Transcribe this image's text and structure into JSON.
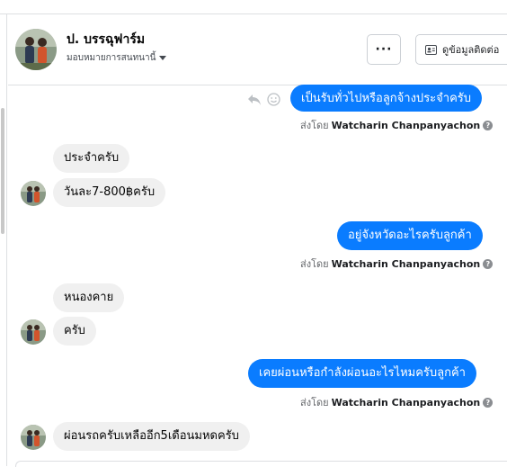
{
  "header": {
    "name": "ป. บรรฉุฟาร์ม",
    "assign_label": "มอบหมายการสนทนานี้",
    "more_label": "···",
    "view_label": "ดูข้อมูลติดต่อ"
  },
  "messages": [
    {
      "type": "out",
      "text": "เป็นรับทั่วไปหรือลูกจ้างประจำครับ",
      "sent_prefix": "ส่งโดย",
      "sent_by": "Watcharin Chanpanyachon"
    },
    {
      "type": "in",
      "text": "ประจำครับ"
    },
    {
      "type": "in",
      "text": "วันละ7-800฿ครับ"
    },
    {
      "type": "out",
      "text": "อยู่จังหวัดอะไรครับลูกค้า",
      "sent_prefix": "ส่งโดย",
      "sent_by": "Watcharin Chanpanyachon"
    },
    {
      "type": "in",
      "text": "หนองคาย"
    },
    {
      "type": "in",
      "text": "ครับ"
    },
    {
      "type": "out",
      "text": "เคยผ่อนหรือกำลังผ่อนอะไรไหมครับลูกค้า",
      "sent_prefix": "ส่งโดย",
      "sent_by": "Watcharin Chanpanyachon"
    },
    {
      "type": "in",
      "text": "ผ่อนรถครับเหลืออีก5เดือนมหดครับ"
    }
  ],
  "colors": {
    "outgoing": "#0a7cff",
    "incoming": "#f0f0f0"
  }
}
